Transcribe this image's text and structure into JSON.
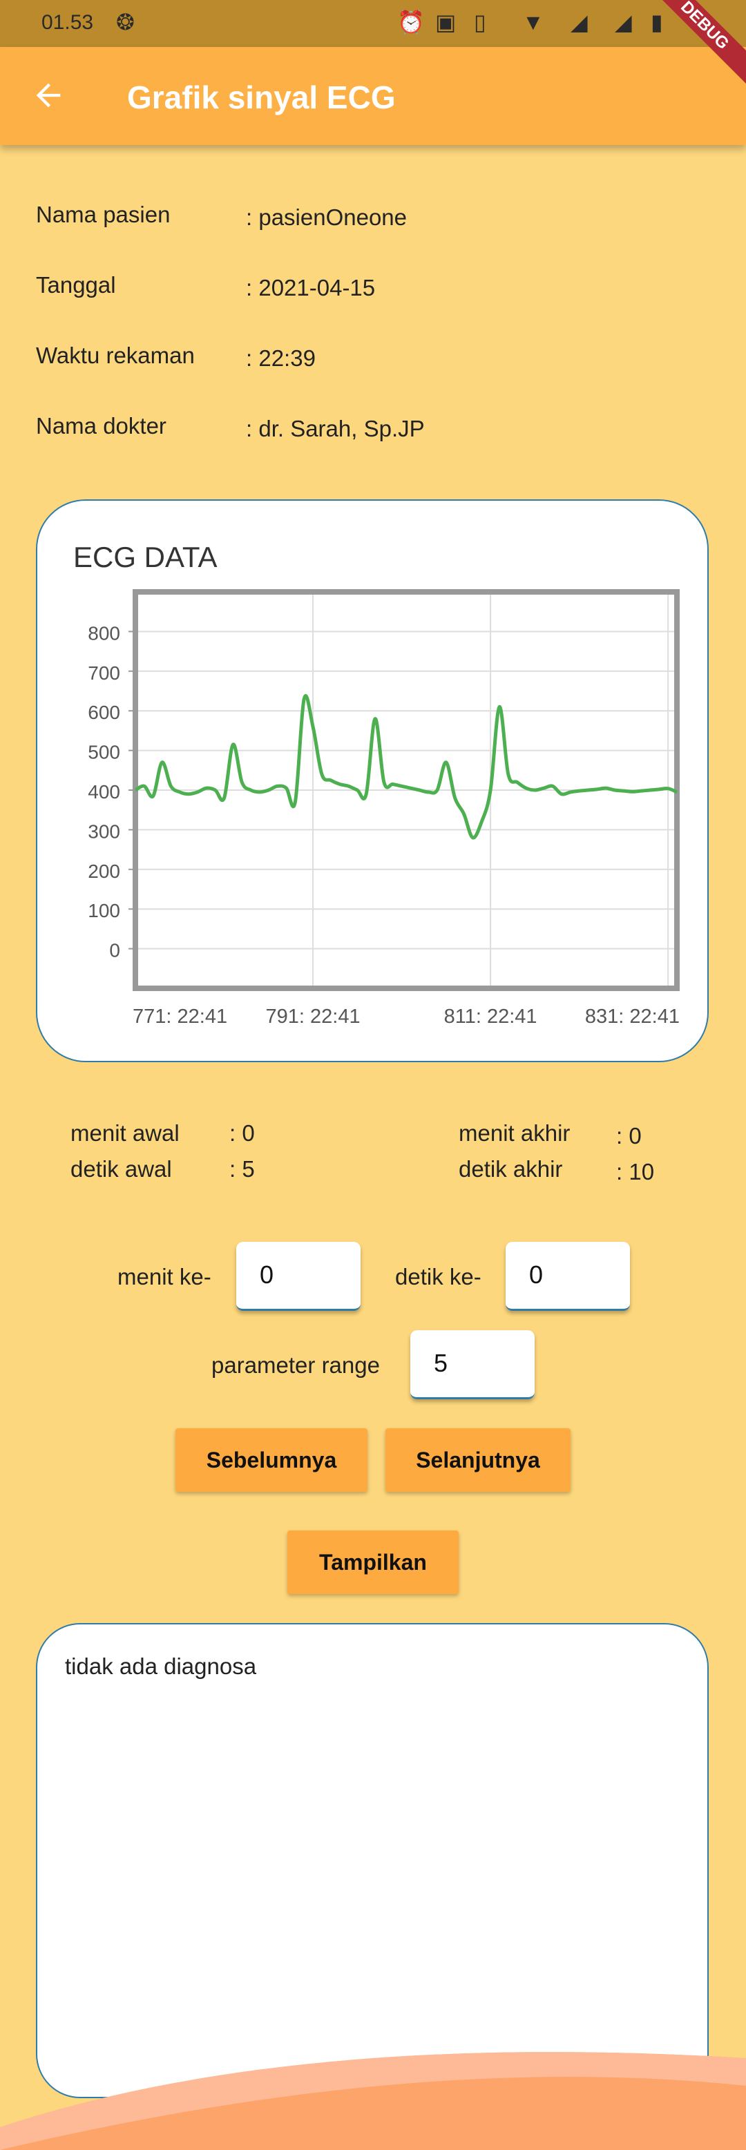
{
  "status_bar": {
    "time": "01.53",
    "debug_label": "DEBUG"
  },
  "app_bar": {
    "title": "Grafik sinyal ECG"
  },
  "patient_info": [
    {
      "label": "Nama pasien",
      "value": ": pasienOneone"
    },
    {
      "label": "Tanggal",
      "value": ": 2021-04-15"
    },
    {
      "label": "Waktu rekaman",
      "value": ": 22:39"
    },
    {
      "label": "Nama dokter",
      "value": ": dr. Sarah, Sp.JP"
    }
  ],
  "chart_data": {
    "type": "line",
    "title": "ECG DATA",
    "x_tick_labels": [
      "771: 22:41",
      "791: 22:41",
      "811: 22:41",
      "831: 22:41"
    ],
    "x_range": [
      771,
      832
    ],
    "y_ticks": [
      0,
      100,
      200,
      300,
      400,
      500,
      600,
      700,
      800
    ],
    "ylim": [
      -100,
      900
    ],
    "grid": true,
    "series": [
      {
        "color": "#4CAF50",
        "x": [
          771,
          772,
          773,
          774,
          775,
          776,
          777,
          778,
          779,
          780,
          781,
          782,
          783,
          784,
          785,
          786,
          787,
          788,
          789,
          790,
          791,
          792,
          793,
          794,
          795,
          796,
          797,
          798,
          799,
          800,
          801,
          802,
          803,
          804,
          805,
          806,
          807,
          808,
          809,
          810,
          811,
          812,
          813,
          814,
          815,
          816,
          817,
          818,
          819,
          820,
          821,
          822,
          823,
          824,
          825,
          826,
          827,
          828,
          829,
          830,
          831,
          832
        ],
        "values": [
          400,
          410,
          385,
          470,
          410,
          395,
          390,
          395,
          405,
          400,
          380,
          515,
          420,
          400,
          395,
          400,
          410,
          405,
          370,
          630,
          560,
          440,
          425,
          415,
          410,
          400,
          390,
          580,
          420,
          415,
          410,
          405,
          400,
          395,
          400,
          470,
          380,
          340,
          280,
          320,
          400,
          610,
          440,
          420,
          405,
          400,
          405,
          410,
          390,
          395,
          398,
          400,
          402,
          405,
          400,
          398,
          396,
          398,
          400,
          402,
          404,
          395
        ]
      }
    ]
  },
  "range_info": {
    "menit_awal_label": "menit awal",
    "menit_awal_value": ": 0",
    "detik_awal_label": "detik awal",
    "detik_awal_value": ": 5",
    "menit_akhir_label": "menit akhir",
    "menit_akhir_value": ": 0",
    "detik_akhir_label": "detik akhir",
    "detik_akhir_value": ": 10"
  },
  "controls": {
    "menit_label": "menit ke-",
    "menit_value": "0",
    "detik_label": "detik ke-",
    "detik_value": "0",
    "range_label": "parameter range",
    "range_value": "5",
    "prev_label": "Sebelumnya",
    "next_label": "Selanjutnya",
    "show_label": "Tampilkan"
  },
  "diagnosis": {
    "text": "tidak ada diagnosa"
  },
  "colors": {
    "background": "#FDD77D",
    "app_bar": "#FDB046",
    "button": "#FDAA40",
    "card_border": "#2F7CA8",
    "ecg_line": "#4CAF50",
    "wave": "#FDA46A"
  }
}
